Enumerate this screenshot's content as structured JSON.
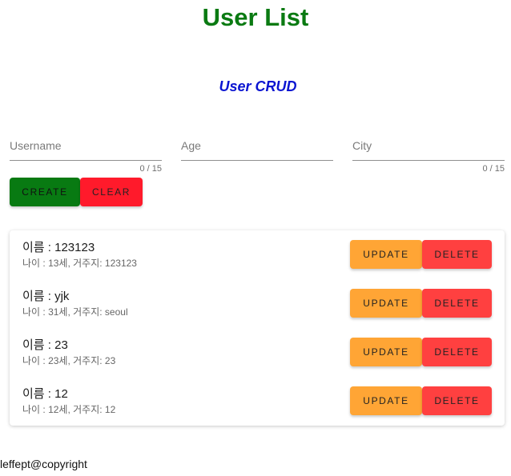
{
  "header": {
    "title": "User List",
    "subtitle": "User CRUD"
  },
  "form": {
    "username": {
      "placeholder": "Username",
      "value": "",
      "counter": "0 / 15"
    },
    "age": {
      "placeholder": "Age",
      "value": ""
    },
    "city": {
      "placeholder": "City",
      "value": "",
      "counter": "0 / 15"
    },
    "create_label": "CREATE",
    "clear_label": "CLEAR"
  },
  "users": [
    {
      "name": "이름 : 123123",
      "detail": "나이 : 13세, 거주지: 123123",
      "update_label": "UPDATE",
      "delete_label": "DELETE"
    },
    {
      "name": "이름 : yjk",
      "detail": "나이 : 31세, 거주지: seoul",
      "update_label": "UPDATE",
      "delete_label": "DELETE"
    },
    {
      "name": "이름 : 23",
      "detail": "나이 : 23세, 거주지: 23",
      "update_label": "UPDATE",
      "delete_label": "DELETE"
    },
    {
      "name": "이름 : 12",
      "detail": "나이 : 12세, 거주지: 12",
      "update_label": "UPDATE",
      "delete_label": "DELETE"
    }
  ],
  "footer": {
    "text": "leffept@copyright"
  },
  "colors": {
    "title": "#0a7a12",
    "subtitle": "#0b15d1",
    "create": "#087a12",
    "clear": "#ff1a2b",
    "update": "#ffa535",
    "delete": "#ff4040"
  }
}
